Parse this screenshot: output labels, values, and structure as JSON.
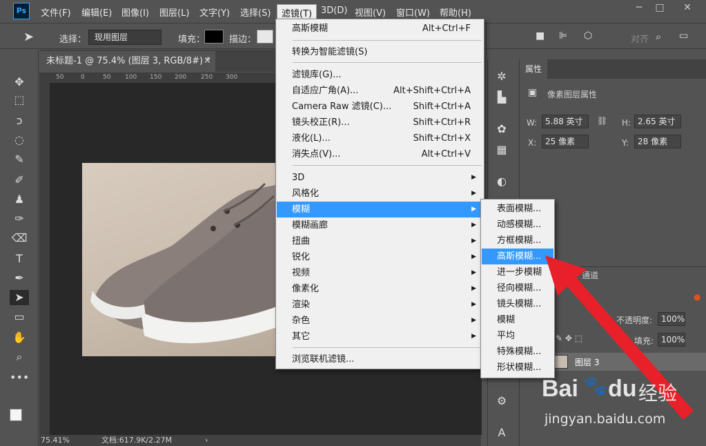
{
  "menubar": {
    "logo": "Ps",
    "items": [
      "文件(F)",
      "编辑(E)",
      "图像(I)",
      "图层(L)",
      "文字(Y)",
      "选择(S)",
      "滤镜(T)",
      "3D(D)",
      "视图(V)",
      "窗口(W)",
      "帮助(H)"
    ],
    "active_index": 6,
    "window_controls": [
      "─",
      "□",
      "✕"
    ]
  },
  "options": {
    "select_label": "选择：",
    "select_value": "现用图层",
    "fill_label": "填充：",
    "stroke_label": "描边：",
    "align_label": "对齐"
  },
  "document": {
    "tab_title": "未标题-1 @ 75.4% (图层 3, RGB/8#) *",
    "tab_close": "✕",
    "ruler_ticks": [
      "50",
      "0",
      "50",
      "100",
      "150",
      "200",
      "250",
      "300"
    ],
    "zoom": "75.41%",
    "doc_size": "文档:617.9K/2.27M"
  },
  "properties": {
    "tab": "属性",
    "type": "像素图层属性",
    "w_label": "W:",
    "w_value": "5.88 英寸",
    "h_label": "H:",
    "h_value": "2.65 英寸",
    "x_label": "X:",
    "x_value": "25 像素",
    "y_label": "Y:",
    "y_value": "28 像素"
  },
  "layers": {
    "channels_tab": "通道",
    "opacity_label": "不透明度:",
    "opacity_value": "100%",
    "fill_label": "填充:",
    "fill_value": "100%",
    "layer_name": "图层 3"
  },
  "filter_menu": {
    "items": [
      {
        "label": "高斯模糊",
        "shortcut": "Alt+Ctrl+F"
      },
      {
        "label": "转换为智能滤镜(S)",
        "shortcut": ""
      },
      {
        "label": "滤镜库(G)...",
        "shortcut": ""
      },
      {
        "label": "自适应广角(A)...",
        "shortcut": "Alt+Shift+Ctrl+A"
      },
      {
        "label": "Camera Raw 滤镜(C)...",
        "shortcut": "Shift+Ctrl+A"
      },
      {
        "label": "镜头校正(R)...",
        "shortcut": "Shift+Ctrl+R"
      },
      {
        "label": "液化(L)...",
        "shortcut": "Shift+Ctrl+X"
      },
      {
        "label": "消失点(V)...",
        "shortcut": "Alt+Ctrl+V"
      },
      {
        "label": "3D",
        "shortcut": ""
      },
      {
        "label": "风格化",
        "shortcut": ""
      },
      {
        "label": "模糊",
        "shortcut": ""
      },
      {
        "label": "模糊画廊",
        "shortcut": ""
      },
      {
        "label": "扭曲",
        "shortcut": ""
      },
      {
        "label": "锐化",
        "shortcut": ""
      },
      {
        "label": "视频",
        "shortcut": ""
      },
      {
        "label": "像素化",
        "shortcut": ""
      },
      {
        "label": "渲染",
        "shortcut": ""
      },
      {
        "label": "杂色",
        "shortcut": ""
      },
      {
        "label": "其它",
        "shortcut": ""
      },
      {
        "label": "浏览联机滤镜...",
        "shortcut": ""
      }
    ],
    "highlighted": "模糊"
  },
  "blur_submenu": {
    "items": [
      "表面模糊...",
      "动感模糊...",
      "方框模糊...",
      "高斯模糊...",
      "进一步模糊",
      "径向模糊...",
      "镜头模糊...",
      "模糊",
      "平均",
      "特殊模糊...",
      "形状模糊..."
    ],
    "highlighted": "高斯模糊..."
  },
  "watermark": {
    "brand": "Bai",
    "brand2": "du",
    "product": "经验",
    "url": "jingyan.baidu.com"
  },
  "colors": {
    "highlight": "#3399ff",
    "arrow": "#e8202a",
    "panel": "#535353",
    "canvas": "#282828"
  }
}
